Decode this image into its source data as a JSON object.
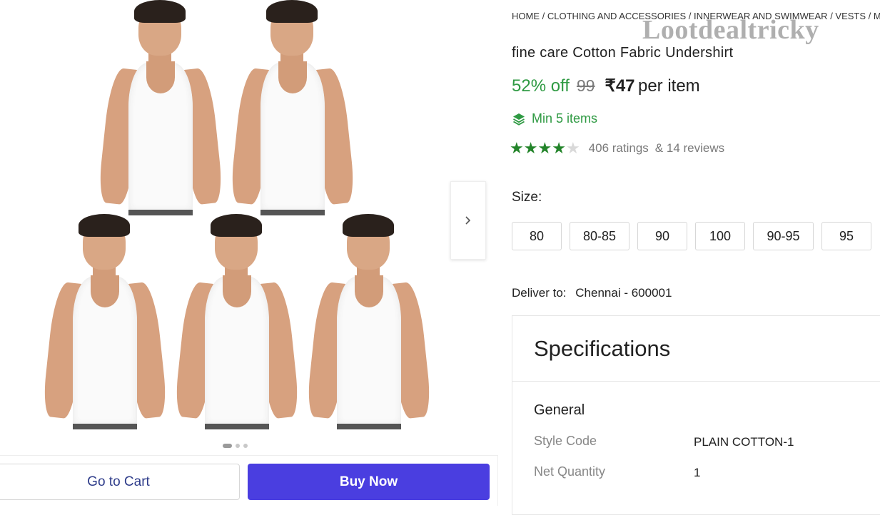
{
  "breadcrumb": [
    "HOME",
    "CLOTHING AND ACCESSORIES",
    "INNERWEAR AND SWIMWEAR",
    "VESTS",
    "MEN"
  ],
  "watermark": "Lootdealtricky",
  "product": {
    "title": "fine care Cotton Fabric Undershirt",
    "discount": "52% off",
    "mrp": "99",
    "price": "₹47",
    "per_unit": "per item",
    "min_items": "Min 5 items",
    "rating_value": 4,
    "rating_max": 5,
    "ratings_text": "406 ratings",
    "reviews_text": "& 14 reviews"
  },
  "size": {
    "label": "Size:",
    "options": [
      "80",
      "80-85",
      "90",
      "100",
      "90-95",
      "95"
    ]
  },
  "delivery": {
    "label": "Deliver to:",
    "location": "Chennai - 600001"
  },
  "specifications": {
    "title": "Specifications",
    "group": "General",
    "rows": [
      {
        "key": "Style Code",
        "value": "PLAIN COTTON-1"
      },
      {
        "key": "Net Quantity",
        "value": "1"
      }
    ]
  },
  "gallery": {
    "image_count": 3,
    "active_index": 0
  },
  "actions": {
    "cart_label": "Go to Cart",
    "buy_label": "Buy Now"
  },
  "colors": {
    "accent_green": "#2f9a43",
    "buy_button": "#4a3ee0",
    "cart_text": "#2e3c8a"
  }
}
